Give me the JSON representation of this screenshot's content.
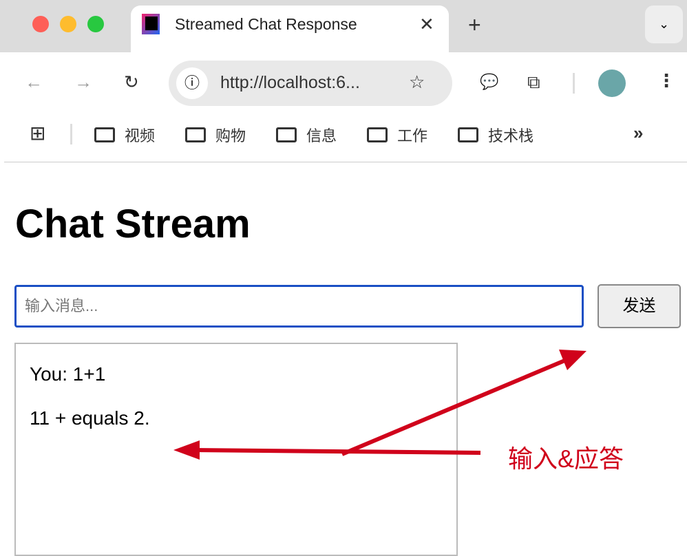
{
  "browser": {
    "tab_title": "Streamed Chat Response",
    "url": "http://localhost:6...",
    "bookmarks": [
      "视频",
      "购物",
      "信息",
      "工作",
      "技术栈"
    ]
  },
  "page": {
    "title": "Chat Stream",
    "input_placeholder": "输入消息...",
    "send_label": "发送",
    "messages": [
      "You: 1+1",
      "11 + equals 2."
    ]
  },
  "annotation": {
    "text": "输入&应答",
    "color": "#d0021b"
  }
}
